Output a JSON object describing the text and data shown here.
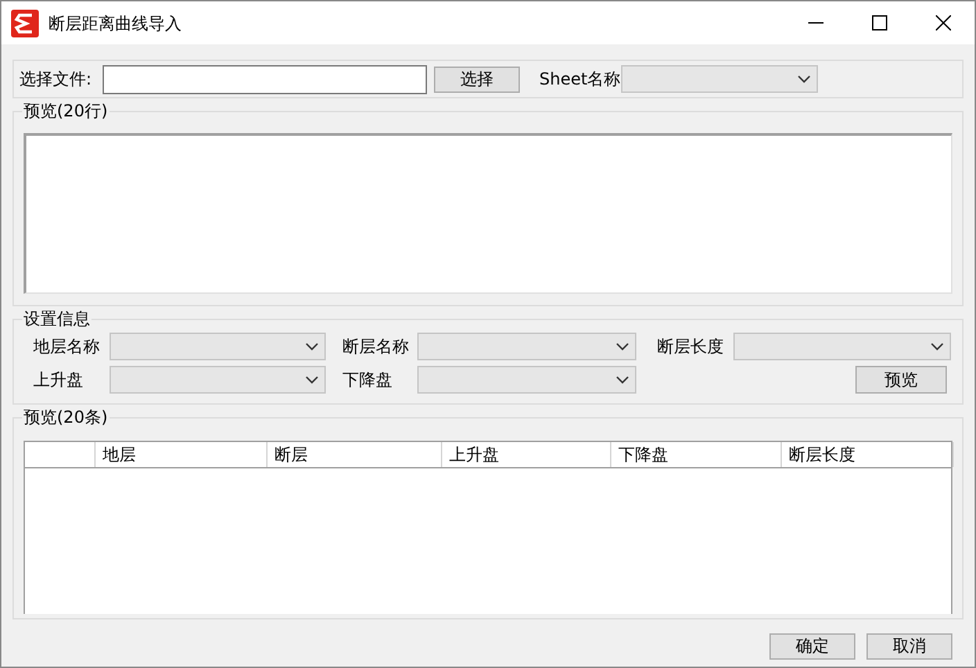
{
  "window": {
    "title": "断层距离曲线导入"
  },
  "file_row": {
    "label": "选择文件:",
    "browse_button": "选择",
    "sheet_label": "Sheet名称",
    "sheet_disabled": true
  },
  "raw_preview": {
    "title": "预览(20行)"
  },
  "settings": {
    "title": "设置信息",
    "fields": [
      {
        "label": "地层名称",
        "disabled": true
      },
      {
        "label": "断层名称",
        "disabled": true
      },
      {
        "label": "断层长度",
        "disabled": true
      },
      {
        "label": "上升盘",
        "disabled": true
      },
      {
        "label": "下降盘",
        "disabled": true
      }
    ],
    "preview_button": "预览"
  },
  "result_preview": {
    "title": "预览(20条)",
    "columns": [
      "地层",
      "断层",
      "上升盘",
      "下降盘",
      "断层长度"
    ]
  },
  "buttons": [
    "确定",
    "取消"
  ]
}
